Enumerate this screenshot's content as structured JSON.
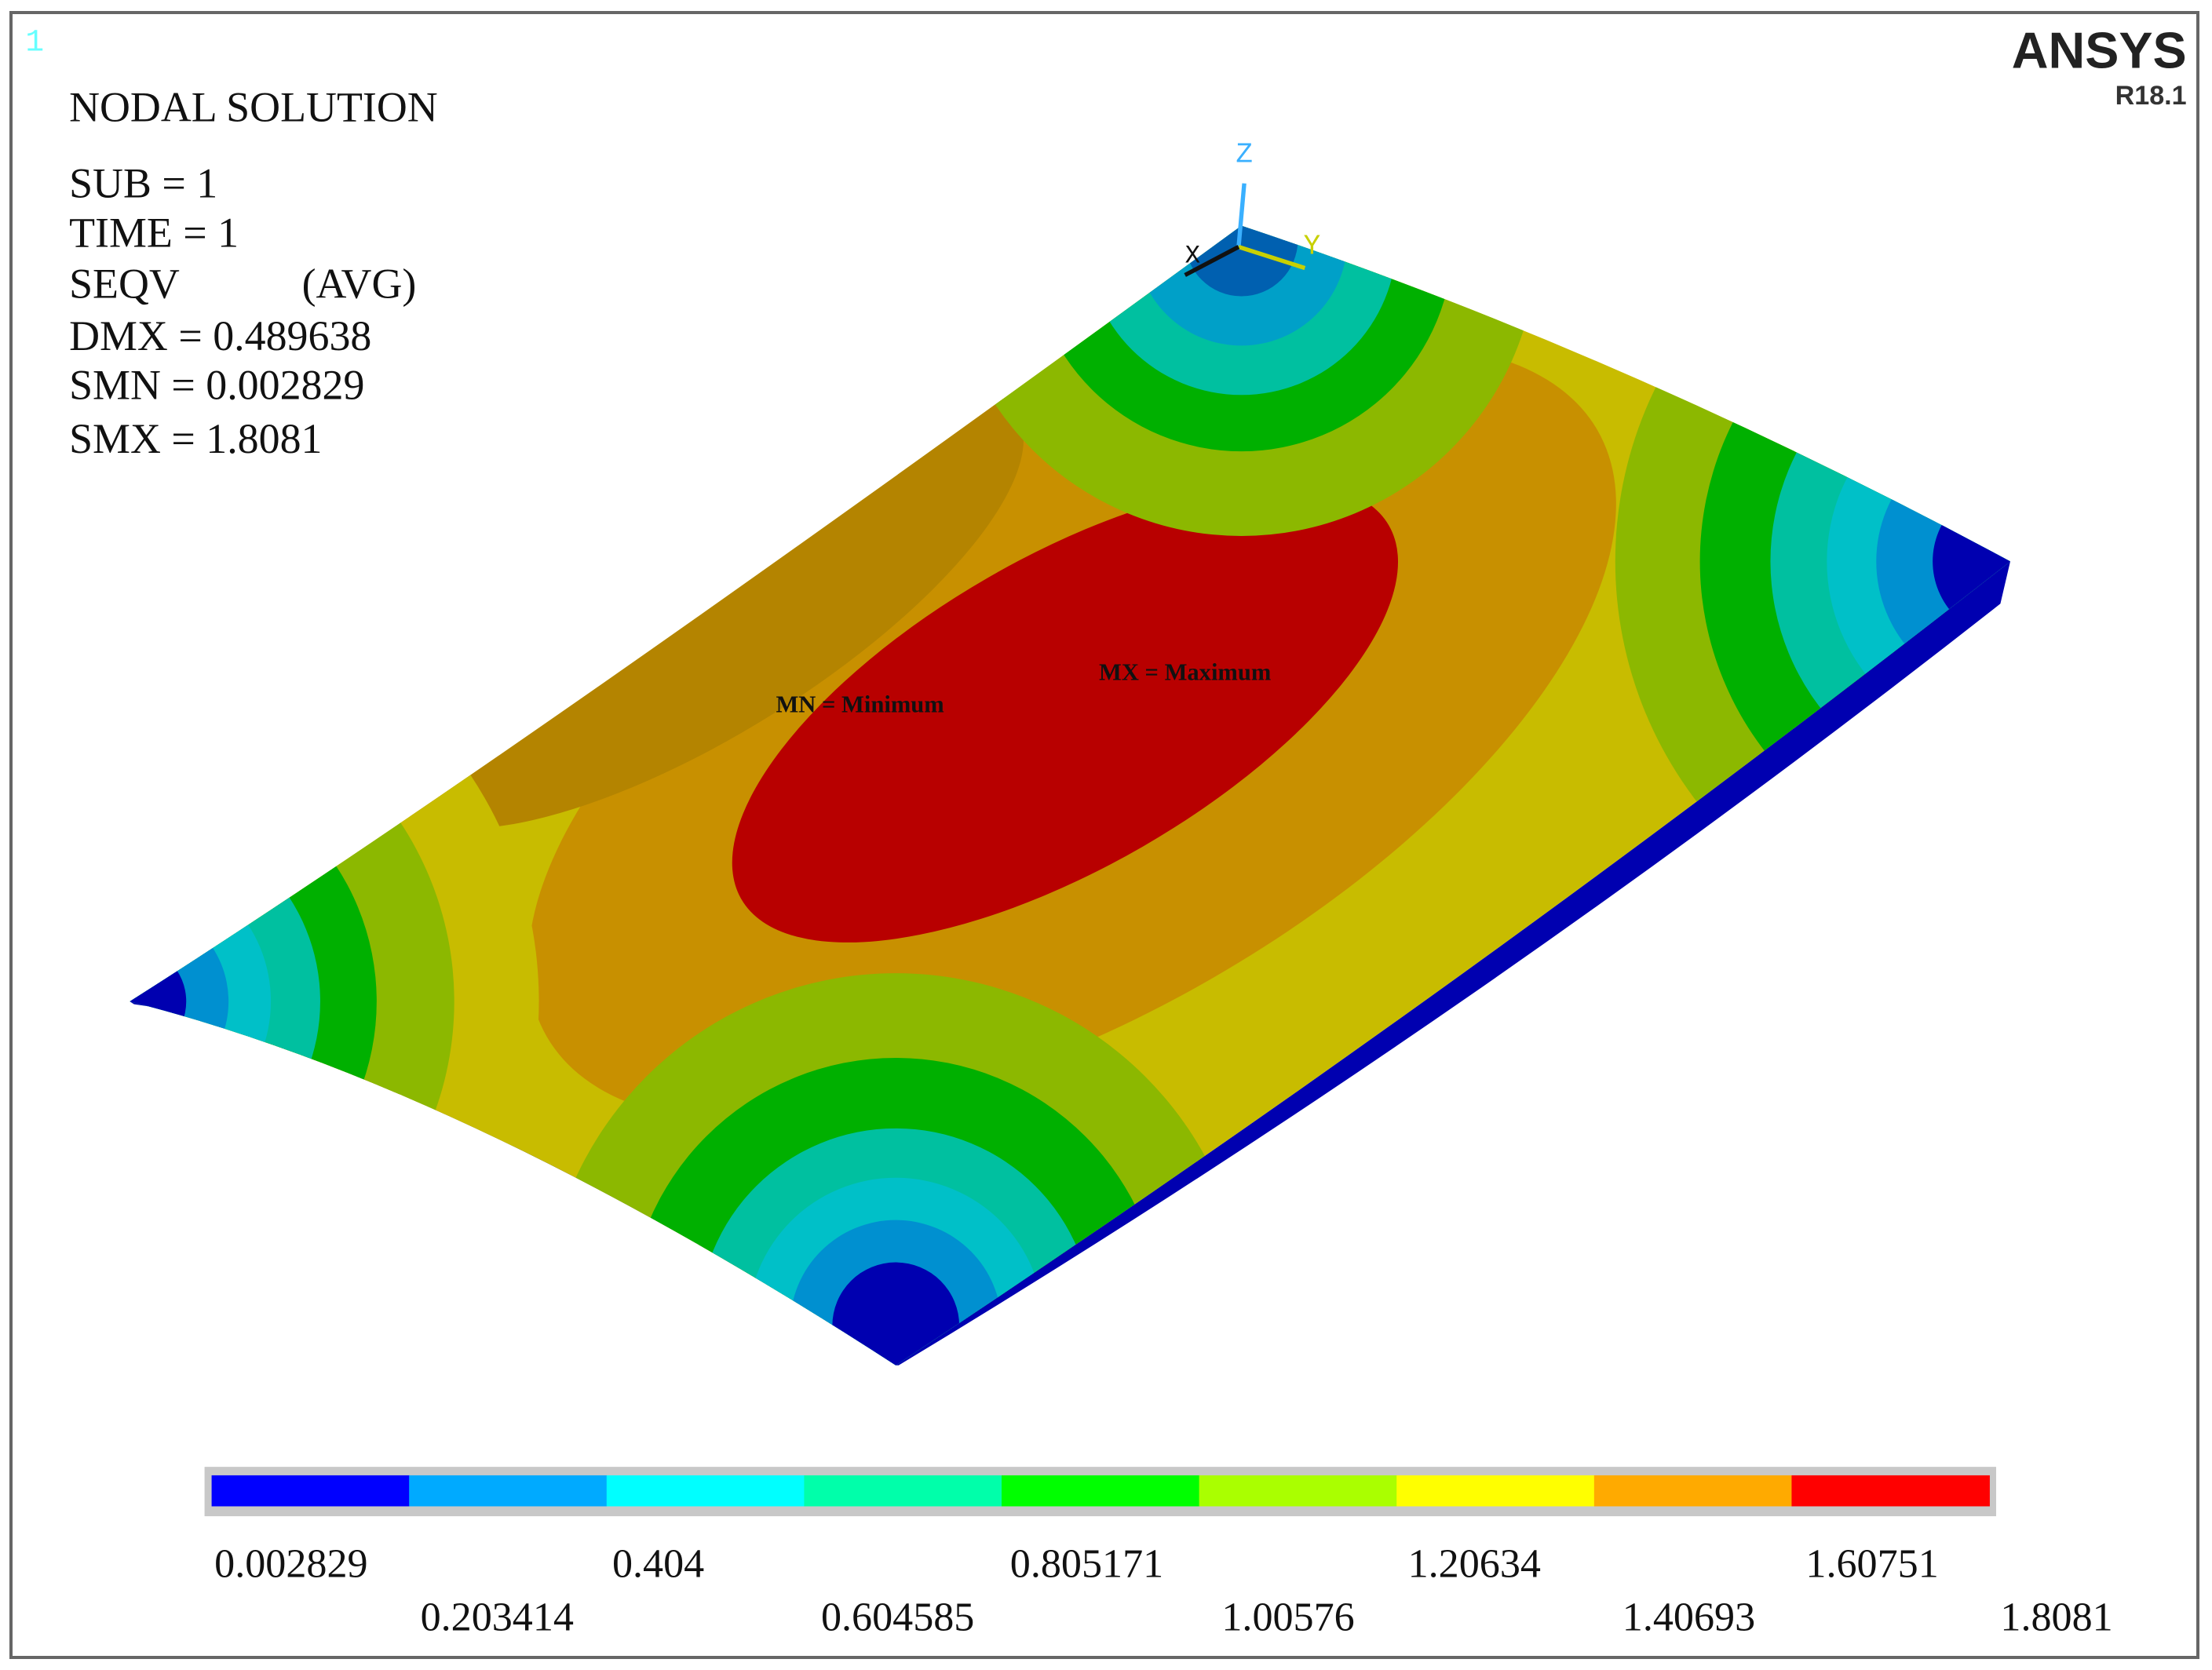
{
  "window_number": "1",
  "info": {
    "title": "NODAL SOLUTION",
    "sub": "SUB = 1",
    "time": "TIME = 1",
    "quantity": "SEQV",
    "avg": "(AVG)",
    "dmx": "DMX = 0.489638",
    "smn": "SMN = 0.002829",
    "smx": "SMX = 1.8081"
  },
  "logo": {
    "brand": "ANSYS",
    "release": "R18.1"
  },
  "triad": {
    "z": "Z",
    "y": "Y",
    "x": "X"
  },
  "markers": {
    "mn": "MN = Minimum",
    "mx": "MX = Maximum"
  },
  "legend": {
    "colors": [
      "#0000ff",
      "#00aaff",
      "#00ffff",
      "#00ffaa",
      "#00ff00",
      "#aaff00",
      "#ffff00",
      "#ffaa00",
      "#ff0000"
    ],
    "labels_top": [
      "0.002829",
      "0.404",
      "0.805171",
      "1.20634",
      "1.60751"
    ],
    "labels_bottom": [
      "0.203414",
      "0.604585",
      "1.00576",
      "1.40693",
      "1.8081"
    ]
  }
}
